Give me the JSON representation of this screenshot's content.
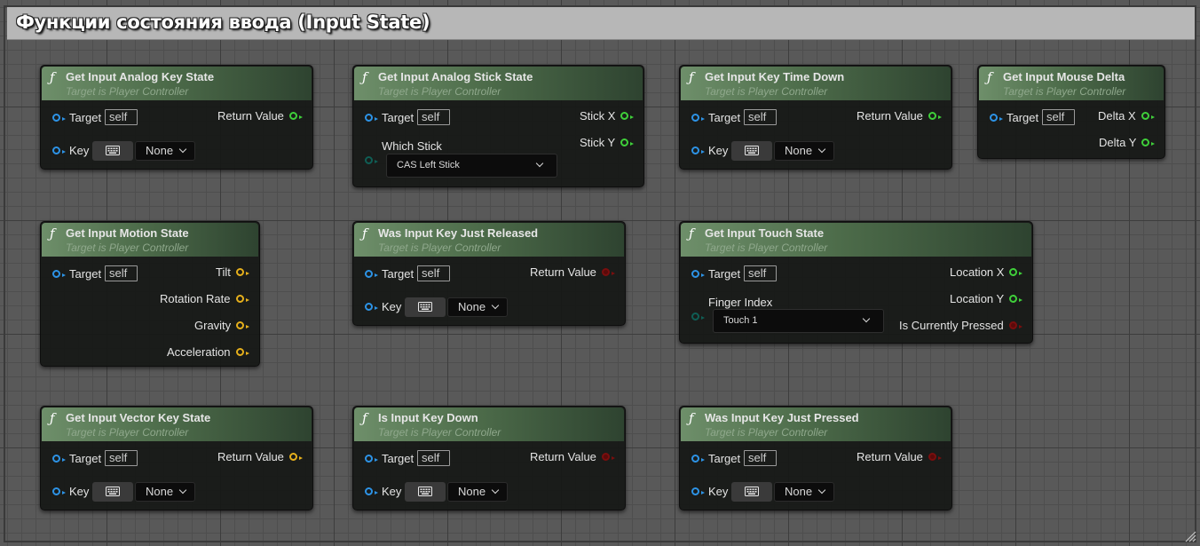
{
  "comment": {
    "title": "Функции состояния ввода (Input State)"
  },
  "common": {
    "subtitle": "Target is Player Controller",
    "target": "Target",
    "self": "self",
    "key": "Key",
    "none": "None",
    "return_value": "Return Value"
  },
  "nodes": {
    "analog_key": {
      "title": "Get Input Analog Key State"
    },
    "analog_stick": {
      "title": "Get Input Analog Stick State",
      "which_stick": "Which Stick",
      "stick_value": "CAS Left Stick",
      "out1": "Stick X",
      "out2": "Stick Y"
    },
    "key_time": {
      "title": "Get Input Key Time Down"
    },
    "mouse_delta": {
      "title": "Get Input Mouse Delta",
      "out1": "Delta X",
      "out2": "Delta Y"
    },
    "motion": {
      "title": "Get Input Motion State",
      "out1": "Tilt",
      "out2": "Rotation Rate",
      "out3": "Gravity",
      "out4": "Acceleration"
    },
    "released": {
      "title": "Was Input Key Just Released"
    },
    "touch": {
      "title": "Get Input Touch State",
      "finger_index": "Finger Index",
      "finger_value": "Touch 1",
      "out1": "Location X",
      "out2": "Location Y",
      "out3": "Is Currently Pressed"
    },
    "vector_key": {
      "title": "Get Input Vector Key State"
    },
    "key_down": {
      "title": "Is Input Key Down"
    },
    "pressed": {
      "title": "Was Input Key Just Pressed"
    }
  },
  "colors": {
    "header_light": "#6e8f6a",
    "header_dark": "#2e4330",
    "pin_object": "#2d93e6",
    "pin_float": "#3fcf3a",
    "pin_vector": "#e6b01c",
    "pin_bool": "#7a0e0e",
    "pin_byte": "#0f5e55"
  },
  "icons": {
    "function": "function-f-icon",
    "keyboard": "keyboard-icon",
    "dropdown": "chevron-down-icon",
    "grip": "resize-grip-icon"
  }
}
